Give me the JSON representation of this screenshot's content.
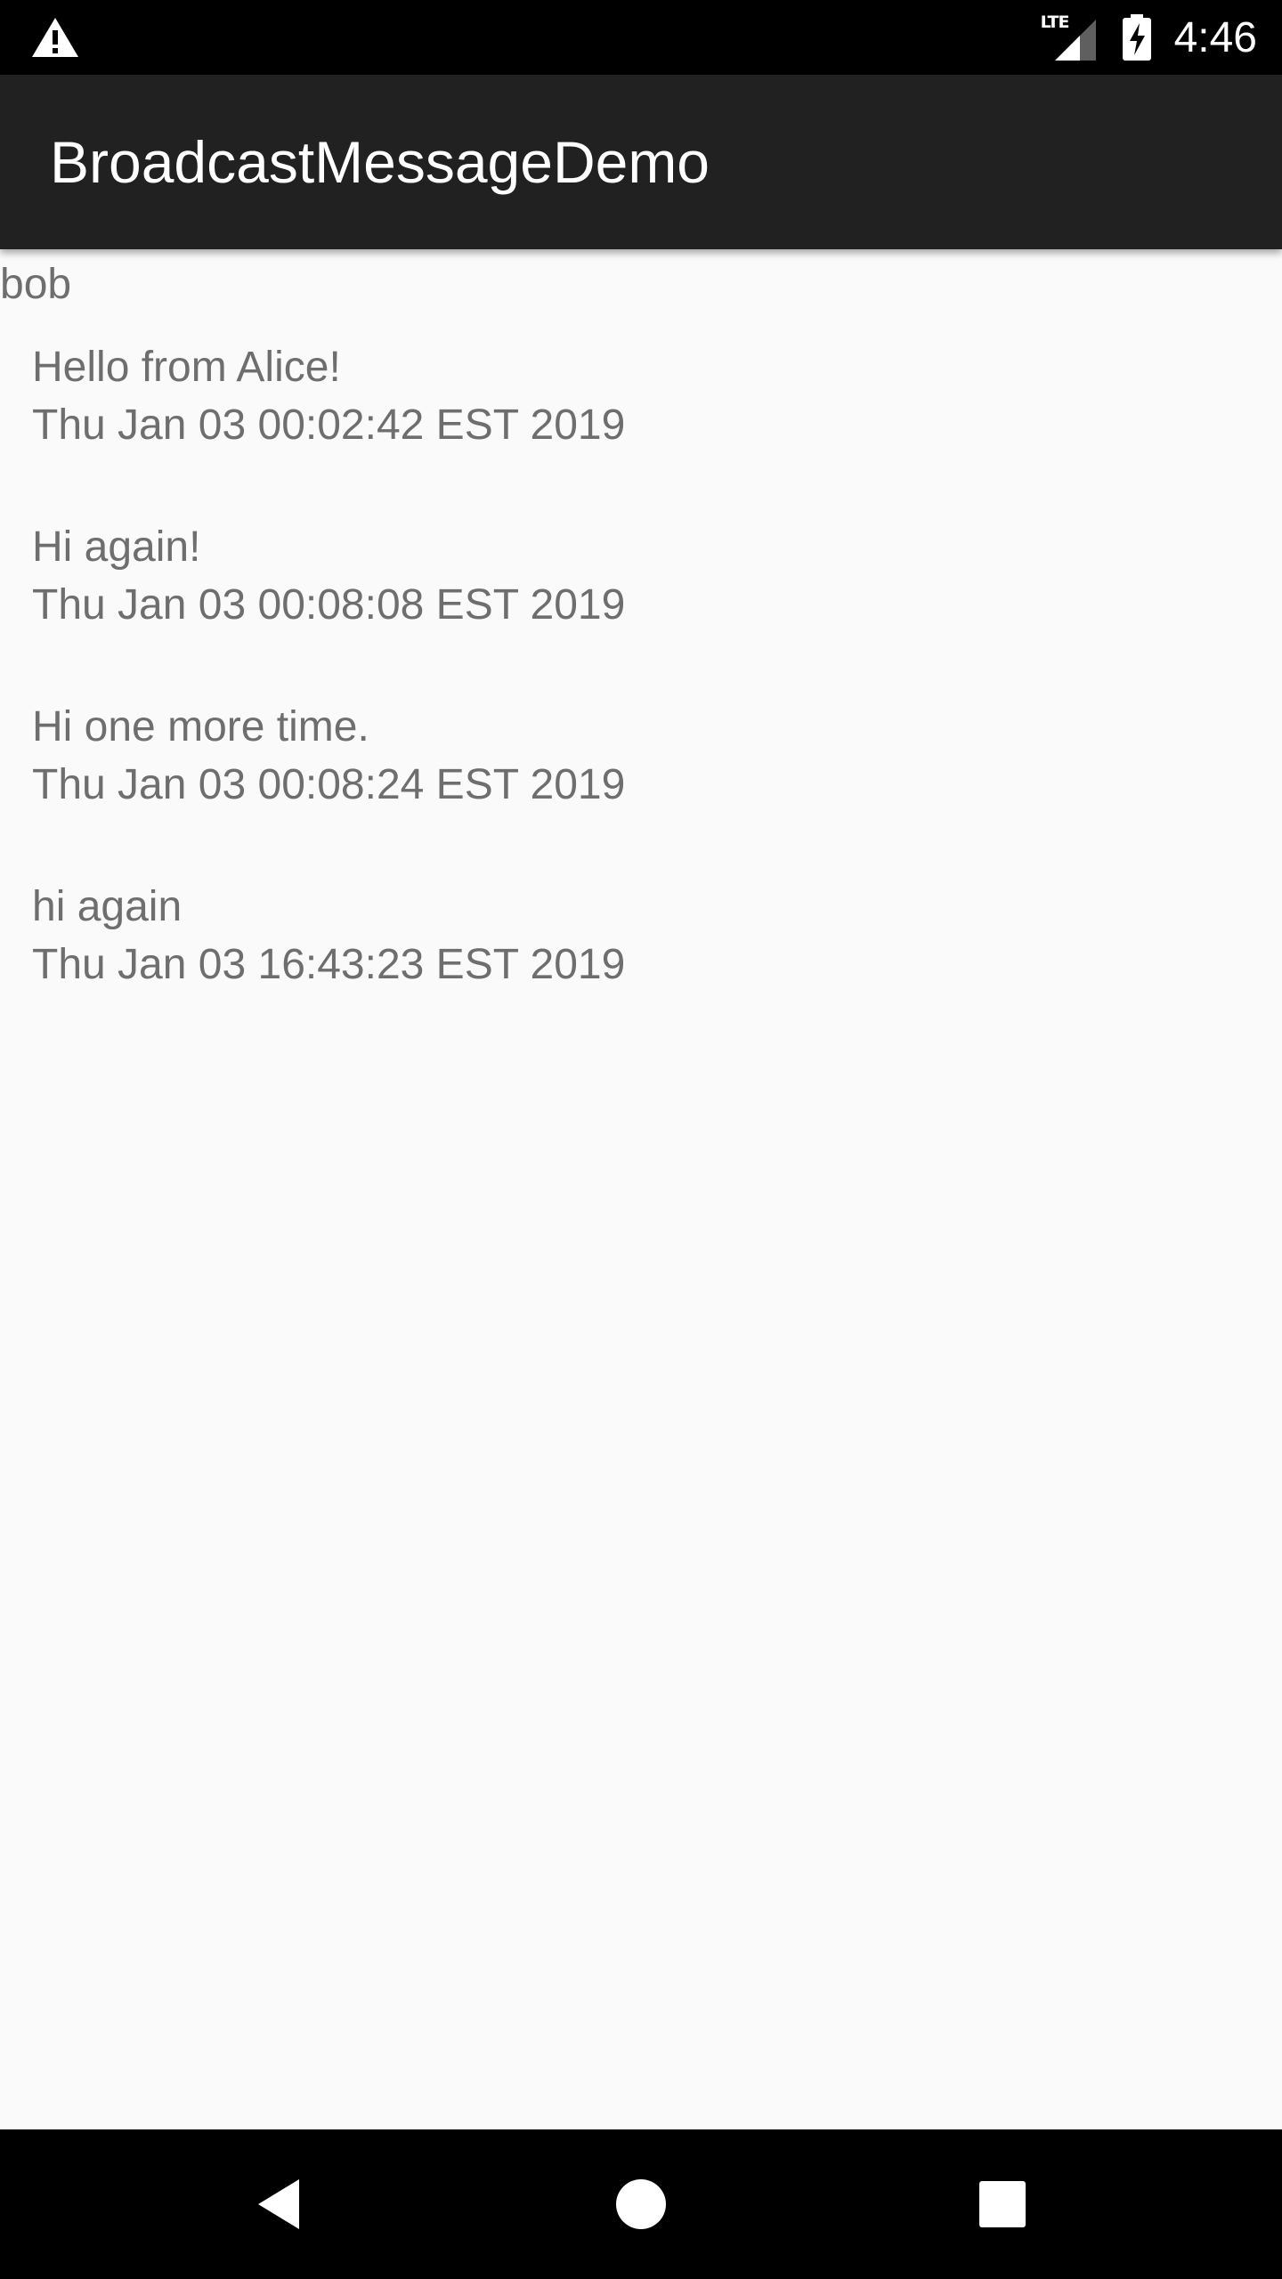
{
  "status_bar": {
    "network_label": "LTE",
    "time": "4:46",
    "icons": [
      "warning-icon",
      "signal-icon",
      "battery-charging-icon"
    ]
  },
  "app_bar": {
    "title": "BroadcastMessageDemo"
  },
  "content": {
    "user": "bob",
    "messages": [
      {
        "text": "Hello from Alice!",
        "timestamp": "Thu Jan 03 00:02:42 EST 2019"
      },
      {
        "text": "Hi again!",
        "timestamp": "Thu Jan 03 00:08:08 EST 2019"
      },
      {
        "text": "Hi one more time.",
        "timestamp": "Thu Jan 03 00:08:24 EST 2019"
      },
      {
        "text": "hi again",
        "timestamp": "Thu Jan 03 16:43:23 EST 2019"
      }
    ]
  },
  "nav_bar": {
    "icons": [
      "back-icon",
      "home-icon",
      "recents-icon"
    ]
  },
  "colors": {
    "status_bar_bg": "#000000",
    "app_bar_bg": "#212121",
    "content_bg": "#fafafa",
    "text": "#6e6e6e"
  }
}
